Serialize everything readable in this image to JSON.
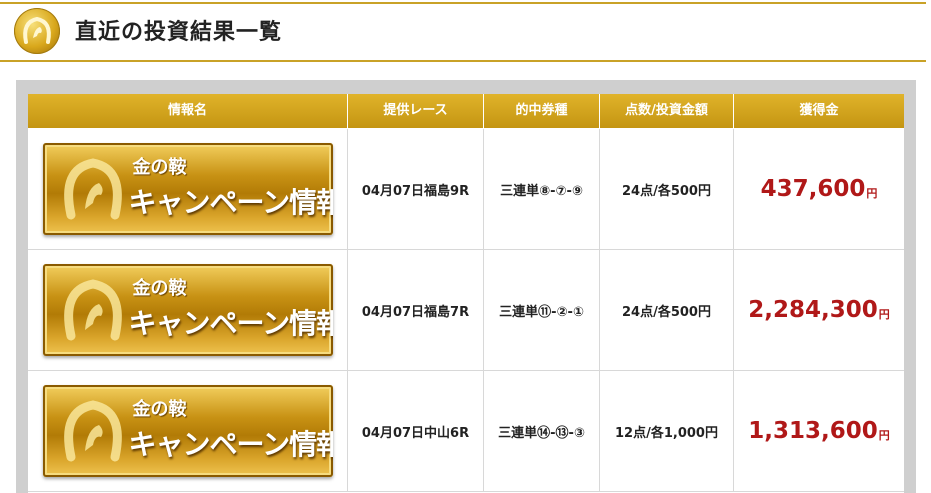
{
  "header": {
    "title": "直近の投資結果一覧",
    "accent_color": "#c9a227"
  },
  "table": {
    "columns": [
      "情報名",
      "提供レース",
      "的中券種",
      "点数/投資金額",
      "獲得金"
    ],
    "rows": [
      {
        "banner_sub": "金の鞍",
        "banner_main": "キャンペーン情報",
        "race": "04月07日福島9R",
        "ticket": "三連単⑧-⑦-⑨",
        "points_investment": "24点/各500円",
        "prize": "437,600",
        "prize_unit": "円"
      },
      {
        "banner_sub": "金の鞍",
        "banner_main": "キャンペーン情報",
        "race": "04月07日福島7R",
        "ticket": "三連単⑪-②-①",
        "points_investment": "24点/各500円",
        "prize": "2,284,300",
        "prize_unit": "円"
      },
      {
        "banner_sub": "金の鞍",
        "banner_main": "キャンペーン情報",
        "race": "04月07日中山6R",
        "ticket": "三連単⑭-⑬-③",
        "points_investment": "12点/各1,000円",
        "prize": "1,313,600",
        "prize_unit": "円"
      }
    ],
    "header_color": "#d4a41d",
    "prize_color": "#b01818"
  }
}
